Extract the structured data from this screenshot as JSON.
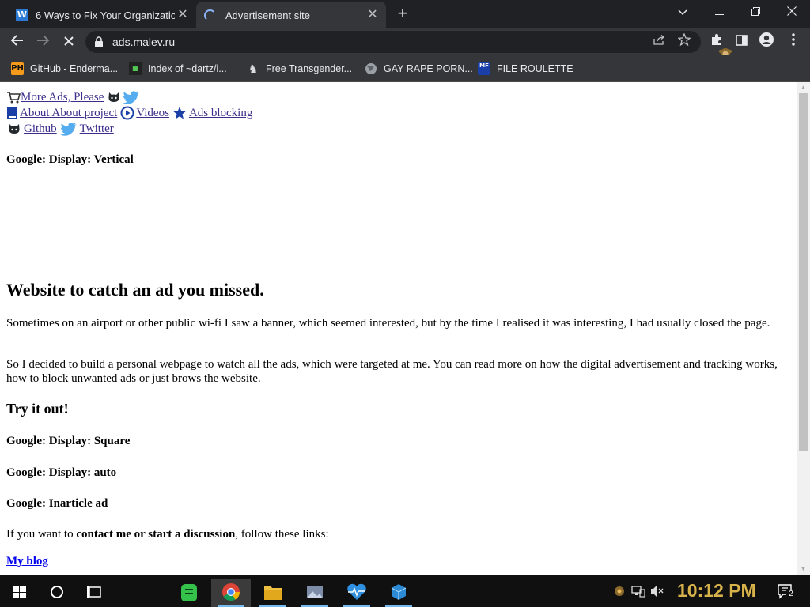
{
  "browser": {
    "tabs": [
      {
        "title": "6 Ways to Fix Your Organizatio",
        "favicon": "W",
        "active": false
      },
      {
        "title": "Advertisement site",
        "favicon": "loading-spinner",
        "active": true
      }
    ],
    "address": "ads.malev.ru",
    "bookmarks": [
      {
        "label": "GitHub - Enderma...",
        "icon": "PH"
      },
      {
        "label": "Index of ~dartz/i...",
        "icon": "dartz"
      },
      {
        "label": "Free Transgender...",
        "icon": "ghost"
      },
      {
        "label": "GAY RAPE PORN...",
        "icon": "globe"
      },
      {
        "label": "FILE ROULETTE",
        "icon": "MF"
      }
    ]
  },
  "page": {
    "nav": {
      "more_ads": "More Ads, Please",
      "about": "About About project",
      "videos": "Videos",
      "ads_blocking": "Ads blocking",
      "github": "Github",
      "twitter": "Twitter"
    },
    "ad_vertical": "Google: Display: Vertical",
    "heading": "Website to catch an ad you missed.",
    "para1": "Sometimes on an airport or other public wi-fi I saw a banner, which seemed interested, but by the time I realised it was interesting, I had usually closed the page.",
    "para2": "So I decided to build a personal webpage to watch all the ads, which were targeted at me. You can read more on how the digital advertisement and tracking works, how to block unwanted ads or just brows the website.",
    "try_heading": "Try it out!",
    "ad_square": "Google: Display: Square",
    "ad_auto": "Google: Display: auto",
    "ad_inarticle": "Google: Inarticle ad",
    "contact_prefix": "If you want to ",
    "contact_bold": "contact me or start a discussion",
    "contact_suffix": ", follow these links:",
    "blog": "My blog"
  },
  "taskbar": {
    "clock": "10:12 PM",
    "notifications": "2"
  },
  "colors": {
    "tab_strip": "#202124",
    "toolbar": "#35363a",
    "link": "#3c2e8c",
    "clock": "#d8b24a"
  }
}
